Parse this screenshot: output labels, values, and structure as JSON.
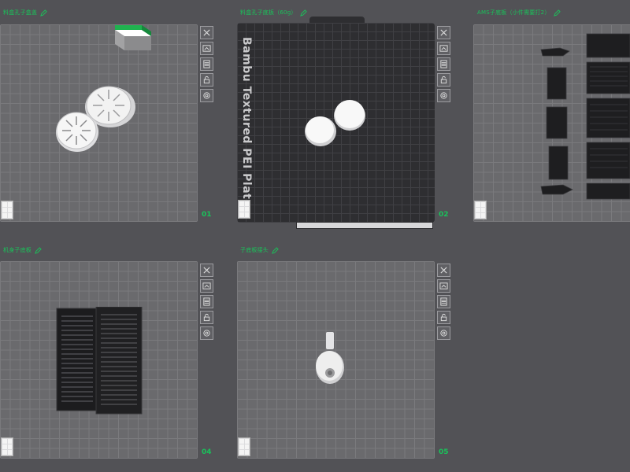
{
  "plates": [
    {
      "title": "料盒孔子盒盖",
      "number": "01"
    },
    {
      "title": "料盒孔子底板（60g）",
      "number": "02",
      "plate_label": "Bambu Textured PEI Plate"
    },
    {
      "title": "AMS子底板（小件需要打2）",
      "number": ""
    },
    {
      "title": "机身子底板",
      "number": "04"
    },
    {
      "title": "子底板接头",
      "number": "05"
    }
  ],
  "toolbar_icons": [
    "close-icon",
    "arrange-icon",
    "slice-icon",
    "lock-icon",
    "settings-icon"
  ],
  "colors": {
    "accent": "#19c35a",
    "background": "#525256",
    "plate": "#6a6a6d",
    "plate_dark": "#2e2e31"
  }
}
